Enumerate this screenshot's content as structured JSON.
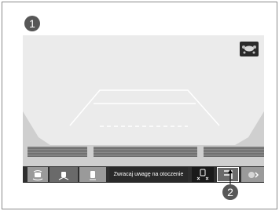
{
  "callouts": [
    "1",
    "2"
  ],
  "camera_view": {
    "guidelines": "on"
  },
  "toolbar": {
    "message": "Zwracaj uwagę na otoczenie",
    "buttons": [
      {
        "icon": "front-sensor-icon"
      },
      {
        "icon": "side-view-icon"
      },
      {
        "icon": "rear-sensor-icon"
      },
      {
        "icon": "car-distance-icon"
      },
      {
        "icon": "guideline-toggle-icon"
      },
      {
        "icon": "camera-switch-icon"
      }
    ]
  },
  "colors": {
    "screen_bg": "#ebebeb",
    "ground": "#cfcfcf",
    "toolbar_bg": "#2f2f2f",
    "badge": "#575757"
  }
}
